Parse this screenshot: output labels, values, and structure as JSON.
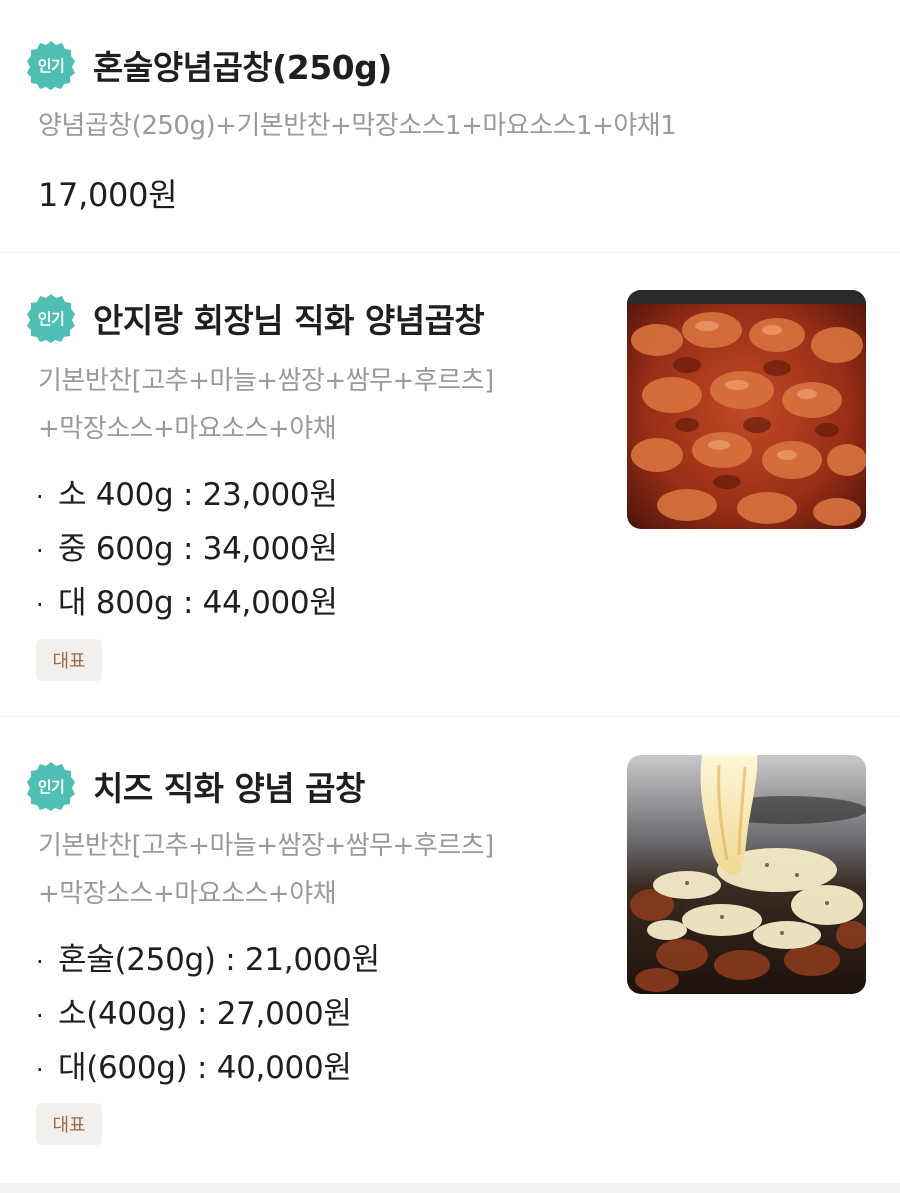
{
  "items": [
    {
      "badge": "인기",
      "title": "혼술양념곱창(250g)",
      "description_lines": [
        "양념곱창(250g)+기본반찬+막장소스1+마요소스1+야채1"
      ],
      "price": "17,000원"
    },
    {
      "badge": "인기",
      "title": "안지랑 회장님 직화 양념곱창",
      "description_lines": [
        "기본반찬[고추+마늘+쌈장+쌈무+후르츠]",
        "+막장소스+마요소스+야채"
      ],
      "options": [
        "소 400g : 23,000원",
        "중 600g : 34,000원",
        "대 800g : 44,000원"
      ],
      "tag": "대표",
      "image": "spicy-grilled-gopchang-photo"
    },
    {
      "badge": "인기",
      "title": "치즈 직화 양념 곱창",
      "description_lines": [
        "기본반찬[고추+마늘+쌈장+쌈무+후르츠]",
        "+막장소스+마요소스+야채"
      ],
      "options": [
        "혼술(250g) : 21,000원",
        "소(400g) : 27,000원",
        "대(600g) : 40,000원"
      ],
      "tag": "대표",
      "image": "cheese-gopchang-photo"
    }
  ],
  "colors": {
    "badge": "#4fbfb3",
    "tag_bg": "#f3efea",
    "tag_text": "#9a6a4b",
    "desc": "#9a9a9a"
  }
}
